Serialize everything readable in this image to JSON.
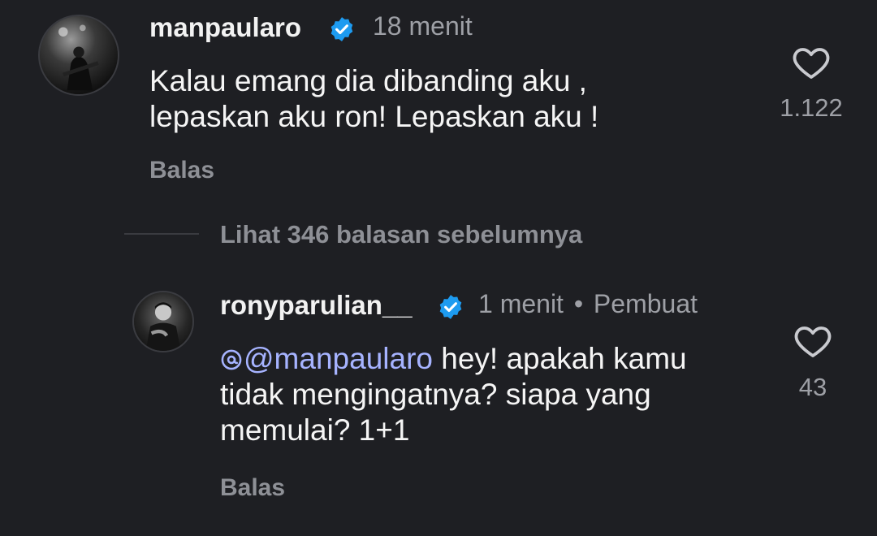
{
  "comments": [
    {
      "username": "manpaularo",
      "verified": true,
      "time": "18 menit",
      "text_lines": [
        "Kalau emang dia dibanding aku ,",
        "lepaskan aku ron! Lepaskan aku !"
      ],
      "reply_label": "Balas",
      "like_count": "1.122"
    }
  ],
  "view_replies_label": "Lihat 346 balasan sebelumnya",
  "reply": {
    "username": "ronyparulian__",
    "verified": true,
    "time": "1 menit",
    "separator": "•",
    "creator_label": "Pembuat",
    "mention": "@manpaularo",
    "text_lines": [
      " hey! apakah kamu",
      "tidak mengingatnya? siapa yang",
      "memulai? 1+1"
    ],
    "reply_label": "Balas",
    "like_count": "43"
  },
  "colors": {
    "background": "#1e1f23",
    "verified_badge": "#1d9bf0",
    "mention": "#a6b3ff"
  },
  "icons": [
    "heart-icon",
    "verified-badge-icon",
    "threads-icon"
  ]
}
